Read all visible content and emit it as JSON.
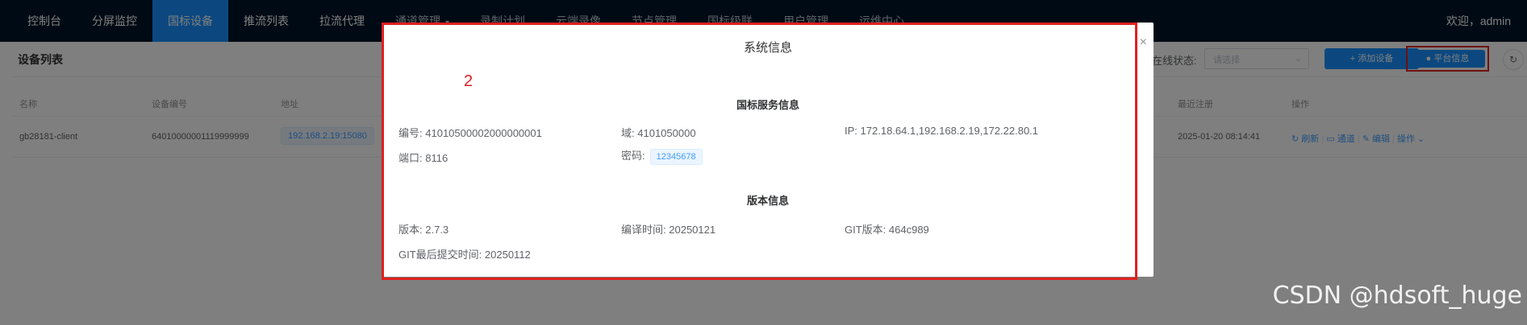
{
  "nav": {
    "items": [
      {
        "label": "控制台"
      },
      {
        "label": "分屏监控"
      },
      {
        "label": "国标设备"
      },
      {
        "label": "推流列表"
      },
      {
        "label": "拉流代理"
      },
      {
        "label": "通道管理"
      },
      {
        "label": "录制计划"
      },
      {
        "label": "云端录像"
      },
      {
        "label": "节点管理"
      },
      {
        "label": "国标级联"
      },
      {
        "label": "用户管理"
      },
      {
        "label": "运维中心"
      }
    ],
    "welcome": "欢迎，admin"
  },
  "page": {
    "title": "设备列表",
    "filter_label": "在线状态:",
    "filter_placeholder": "请选择",
    "add_button": "+ 添加设备",
    "platform_button": "平台信息"
  },
  "table": {
    "headers": {
      "name": "名称",
      "device_id": "设备编号",
      "address": "地址",
      "last_register": "最近注册",
      "actions": "操作"
    },
    "row": {
      "name": "gb28181-client",
      "device_id": "64010000001119999999",
      "address": "192.168.2.19:15080",
      "last_register": "2025-01-20 08:14:41",
      "op_refresh": "刷新",
      "op_channel": "通道",
      "op_edit": "编辑",
      "op_more": "操作"
    }
  },
  "modal": {
    "title": "系统信息",
    "annotation": "2",
    "gb_section": {
      "title": "国标服务信息",
      "id_label": "编号:",
      "id_value": "41010500002000000001",
      "domain_label": "域:",
      "domain_value": "4101050000",
      "ip_label": "IP:",
      "ip_value": "172.18.64.1,192.168.2.19,172.22.80.1",
      "port_label": "端口:",
      "port_value": "8116",
      "password_label": "密码:",
      "password_value": "12345678"
    },
    "version_section": {
      "title": "版本信息",
      "version_label": "版本:",
      "version_value": "2.7.3",
      "build_time_label": "编译时间:",
      "build_time_value": "20250121",
      "git_version_label": "GIT版本:",
      "git_version_value": "464c989",
      "git_commit_label": "GIT最后提交时间:",
      "git_commit_value": "20250112"
    }
  },
  "watermark": "CSDN @hdsoft_huge"
}
